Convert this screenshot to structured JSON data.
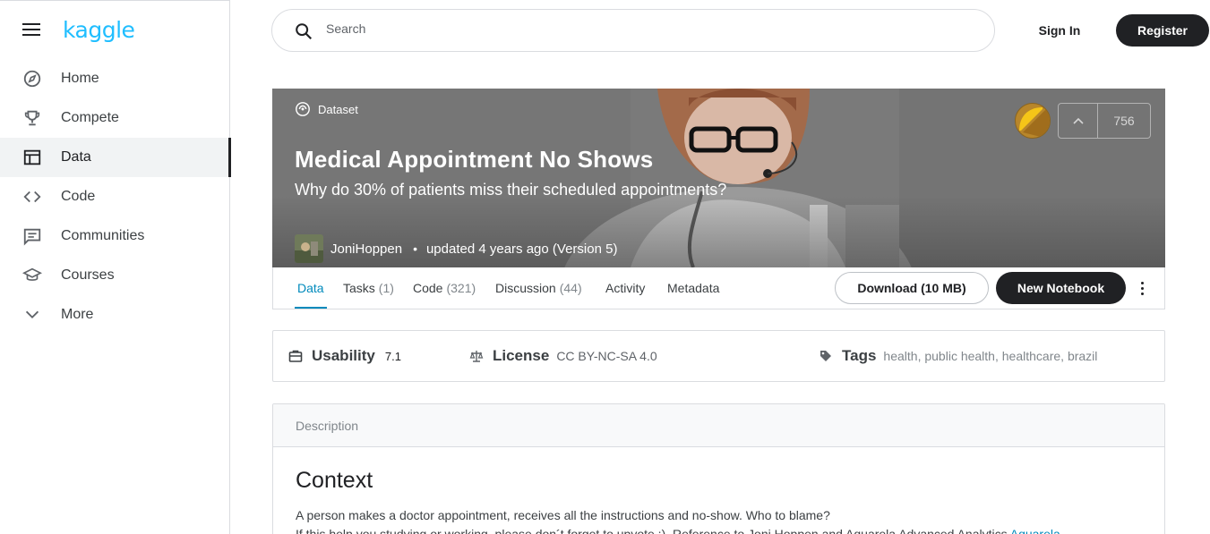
{
  "sidebar": {
    "logo": "kaggle",
    "items": [
      {
        "label": "Home",
        "icon": "compass-icon"
      },
      {
        "label": "Compete",
        "icon": "trophy-icon"
      },
      {
        "label": "Data",
        "icon": "table-icon",
        "active": true
      },
      {
        "label": "Code",
        "icon": "code-icon"
      },
      {
        "label": "Communities",
        "icon": "chat-icon"
      },
      {
        "label": "Courses",
        "icon": "school-icon"
      },
      {
        "label": "More",
        "icon": "chevron-down-icon"
      }
    ]
  },
  "header": {
    "search_placeholder": "Search",
    "signin_label": "Sign In",
    "register_label": "Register"
  },
  "banner": {
    "type_label": "Dataset",
    "title": "Medical Appointment No Shows",
    "subtitle": "Why do 30% of patients miss their scheduled appointments?",
    "author": "JoniHoppen",
    "updated": "updated 4 years ago (Version 5)",
    "upvotes": "756",
    "medal_color": "#b8862b"
  },
  "tabs": [
    {
      "label": "Data",
      "count": ""
    },
    {
      "label": "Tasks",
      "count": "(1)"
    },
    {
      "label": "Code",
      "count": "(321)"
    },
    {
      "label": "Discussion",
      "count": "(44)"
    },
    {
      "label": "Activity",
      "count": ""
    },
    {
      "label": "Metadata",
      "count": ""
    }
  ],
  "actions": {
    "download_label": "Download (10 MB)",
    "new_notebook_label": "New Notebook"
  },
  "info": {
    "usability_label": "Usability",
    "usability_value": "7.1",
    "license_label": "License",
    "license_value": "CC BY-NC-SA 4.0",
    "tags_label": "Tags",
    "tags": [
      "health",
      "public health",
      "healthcare",
      "brazil"
    ]
  },
  "description": {
    "header": "Description",
    "heading": "Context",
    "line1": "A person makes a doctor appointment, receives all the instructions and no-show. Who to blame?",
    "line2": "If this help you studying or working, please don´t forget to upvote :). Reference to Joni Hoppen and Aquarela Advanced Analytics ",
    "line2_link": "Aquarela"
  },
  "colors": {
    "accent": "#20beff",
    "active_tab": "#008abc",
    "dark_button": "#202124"
  }
}
